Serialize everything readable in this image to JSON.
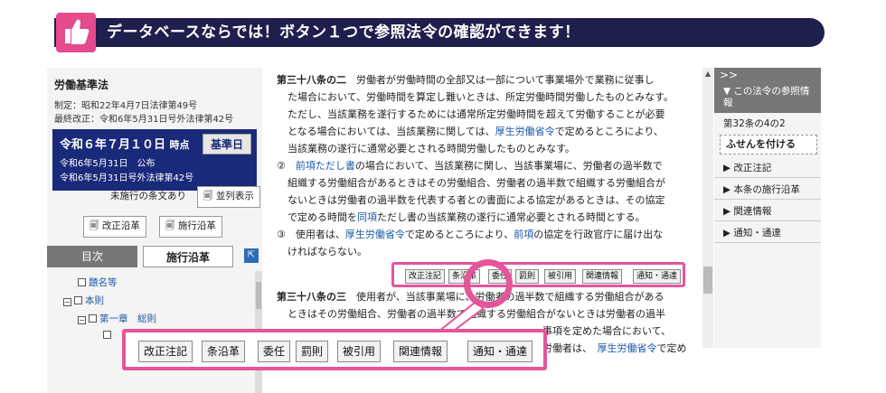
{
  "banner": {
    "text": "データベースならでは！ボタン１つで参照法令の確認ができます！"
  },
  "left": {
    "law_title": "労働基準法",
    "enacted": "制定：昭和22年4月7日法律第49号",
    "last_revised": "最終改正：令和6年5月31日号外法律第42号",
    "date_box": {
      "date": "令和６年７月１０日",
      "point": "時点",
      "standard_btn": "基準日",
      "line1_date": "令和6年5月31日",
      "line1_status": "公布",
      "line2": "令和6年5月31日号外法律第42号"
    },
    "unimplemented": "未施行の条文あり",
    "parallel_btn": "並列表示",
    "revision_btn": "改正沿革",
    "enforce_btn": "施行沿革",
    "tabs": {
      "toc": "目次",
      "enforcement": "施行沿革"
    },
    "tree": [
      {
        "label": "題名等"
      },
      {
        "label": "本則"
      },
      {
        "label": "第一章　総則"
      }
    ]
  },
  "main": {
    "art_num": "第三十八条の二",
    "p1": "労働者が労働時間の全部又は一部について事業場外で業務に従事し",
    "p2": "た場合において、労働時間を算定し難いときは、所定労働時間労働したものとみなす。",
    "p3": "ただし、当該業務を遂行するためには通常所定労働時間を超えて労働することが必要",
    "p4a": "となる場合においては、当該業務に関しては、",
    "p4link": "厚生労働省令",
    "p4b": "で定めるところにより、",
    "p5": "当該業務の遂行に通常必要とされる時間労働したものとみなす。",
    "p6num": "②",
    "p6link": "前項ただし書",
    "p6b": "の場合において、当該業務に関し、当該事業場に、労働者の過半数で",
    "p7": "組織する労働組合があるときはその労働組合、労働者の過半数で組織する労働組合が",
    "p8": "ないときは労働者の過半数を代表する者との書面による協定があるときは、その協定",
    "p9a": "で定める時間を",
    "p9link": "同項",
    "p9b": "ただし書の当該業務の遂行に通常必要とされる時間とする。",
    "p10num": "③",
    "p10a": "使用者は、",
    "p10link": "厚生労働省令",
    "p10b": "で定めるところにより、",
    "p10link2": "前項",
    "p10c": "の協定を行政官庁に届け出な",
    "p11": "ければならない。",
    "art2_num": "第三十八条の三",
    "art2_p1": "使用者が、当該事業場に、労働者の過半数で組織する労働組合がある",
    "art2_p2": "ときはその労働組合、労働者の過半数で組織する労働組合がないときは労働者の過半",
    "art2_p3": "事項を定めた場合において、",
    "art2_p4a": "労働者は、",
    "art2_p4link": "厚生労働省令",
    "art2_p4b": "で定め"
  },
  "toolbar": {
    "revision": "改正注記",
    "article_history": "条沿革",
    "delegation": "委任",
    "penalty": "罰則",
    "cited_by": "被引用",
    "related": "関連情報",
    "notice": "通知・通達"
  },
  "right": {
    "chevron": ">>",
    "ref_laws": "この法令の参照情報",
    "article": "第32条の4の2",
    "sticky": "ふせんを付ける",
    "items": [
      "改正注記",
      "本条の施行沿革",
      "関連情報",
      "通知・通達"
    ]
  },
  "colors": {
    "accent": "#e4559a",
    "navy": "#1f1f4d",
    "link": "#1a57a8"
  }
}
